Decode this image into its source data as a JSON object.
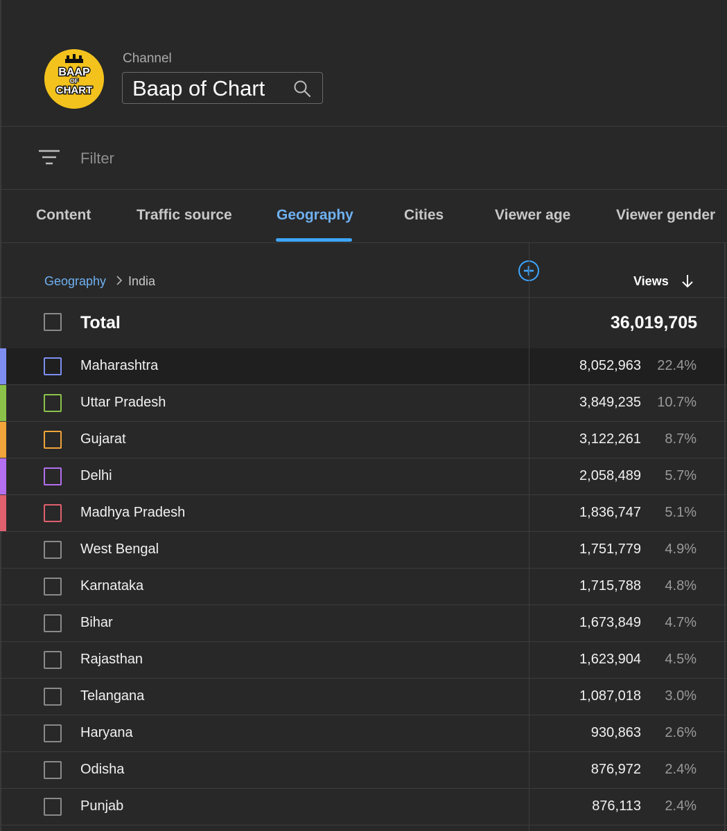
{
  "channel": {
    "label": "Channel",
    "name": "Baap of Chart",
    "logo_text": [
      "BAAP",
      "OF",
      "CHART"
    ]
  },
  "filter": {
    "placeholder": "Filter"
  },
  "tabs": [
    {
      "label": "Content",
      "active": false
    },
    {
      "label": "Traffic source",
      "active": false
    },
    {
      "label": "Geography",
      "active": true
    },
    {
      "label": "Cities",
      "active": false
    },
    {
      "label": "Viewer age",
      "active": false
    },
    {
      "label": "Viewer gender",
      "active": false
    }
  ],
  "table": {
    "breadcrumb": {
      "root": "Geography",
      "current": "India"
    },
    "metric_header": "Views",
    "total": {
      "label": "Total",
      "views": "36,019,705"
    },
    "rows": [
      {
        "label": "Maharashtra",
        "views": "8,052,963",
        "percent": "22.4%",
        "color": "#7d8ef0",
        "selected_color": "#7d8ef0"
      },
      {
        "label": "Uttar Pradesh",
        "views": "3,849,235",
        "percent": "10.7%",
        "color": "#8bc34a",
        "selected_color": "#8bc34a"
      },
      {
        "label": "Gujarat",
        "views": "3,122,261",
        "percent": "8.7%",
        "color": "#f0a43a",
        "selected_color": "#f0a43a"
      },
      {
        "label": "Delhi",
        "views": "2,058,489",
        "percent": "5.7%",
        "color": "#b36ff0",
        "selected_color": "#b36ff0"
      },
      {
        "label": "Madhya Pradesh",
        "views": "1,836,747",
        "percent": "5.1%",
        "color": "#e0606e",
        "selected_color": "#e0606e"
      },
      {
        "label": "West Bengal",
        "views": "1,751,779",
        "percent": "4.9%",
        "color": "",
        "selected_color": ""
      },
      {
        "label": "Karnataka",
        "views": "1,715,788",
        "percent": "4.8%",
        "color": "",
        "selected_color": ""
      },
      {
        "label": "Bihar",
        "views": "1,673,849",
        "percent": "4.7%",
        "color": "",
        "selected_color": ""
      },
      {
        "label": "Rajasthan",
        "views": "1,623,904",
        "percent": "4.5%",
        "color": "",
        "selected_color": ""
      },
      {
        "label": "Telangana",
        "views": "1,087,018",
        "percent": "3.0%",
        "color": "",
        "selected_color": ""
      },
      {
        "label": "Haryana",
        "views": "930,863",
        "percent": "2.6%",
        "color": "",
        "selected_color": ""
      },
      {
        "label": "Odisha",
        "views": "876,972",
        "percent": "2.4%",
        "color": "",
        "selected_color": ""
      },
      {
        "label": "Punjab",
        "views": "876,113",
        "percent": "2.4%",
        "color": "",
        "selected_color": ""
      }
    ]
  },
  "accent_color": "#3ea6ff"
}
